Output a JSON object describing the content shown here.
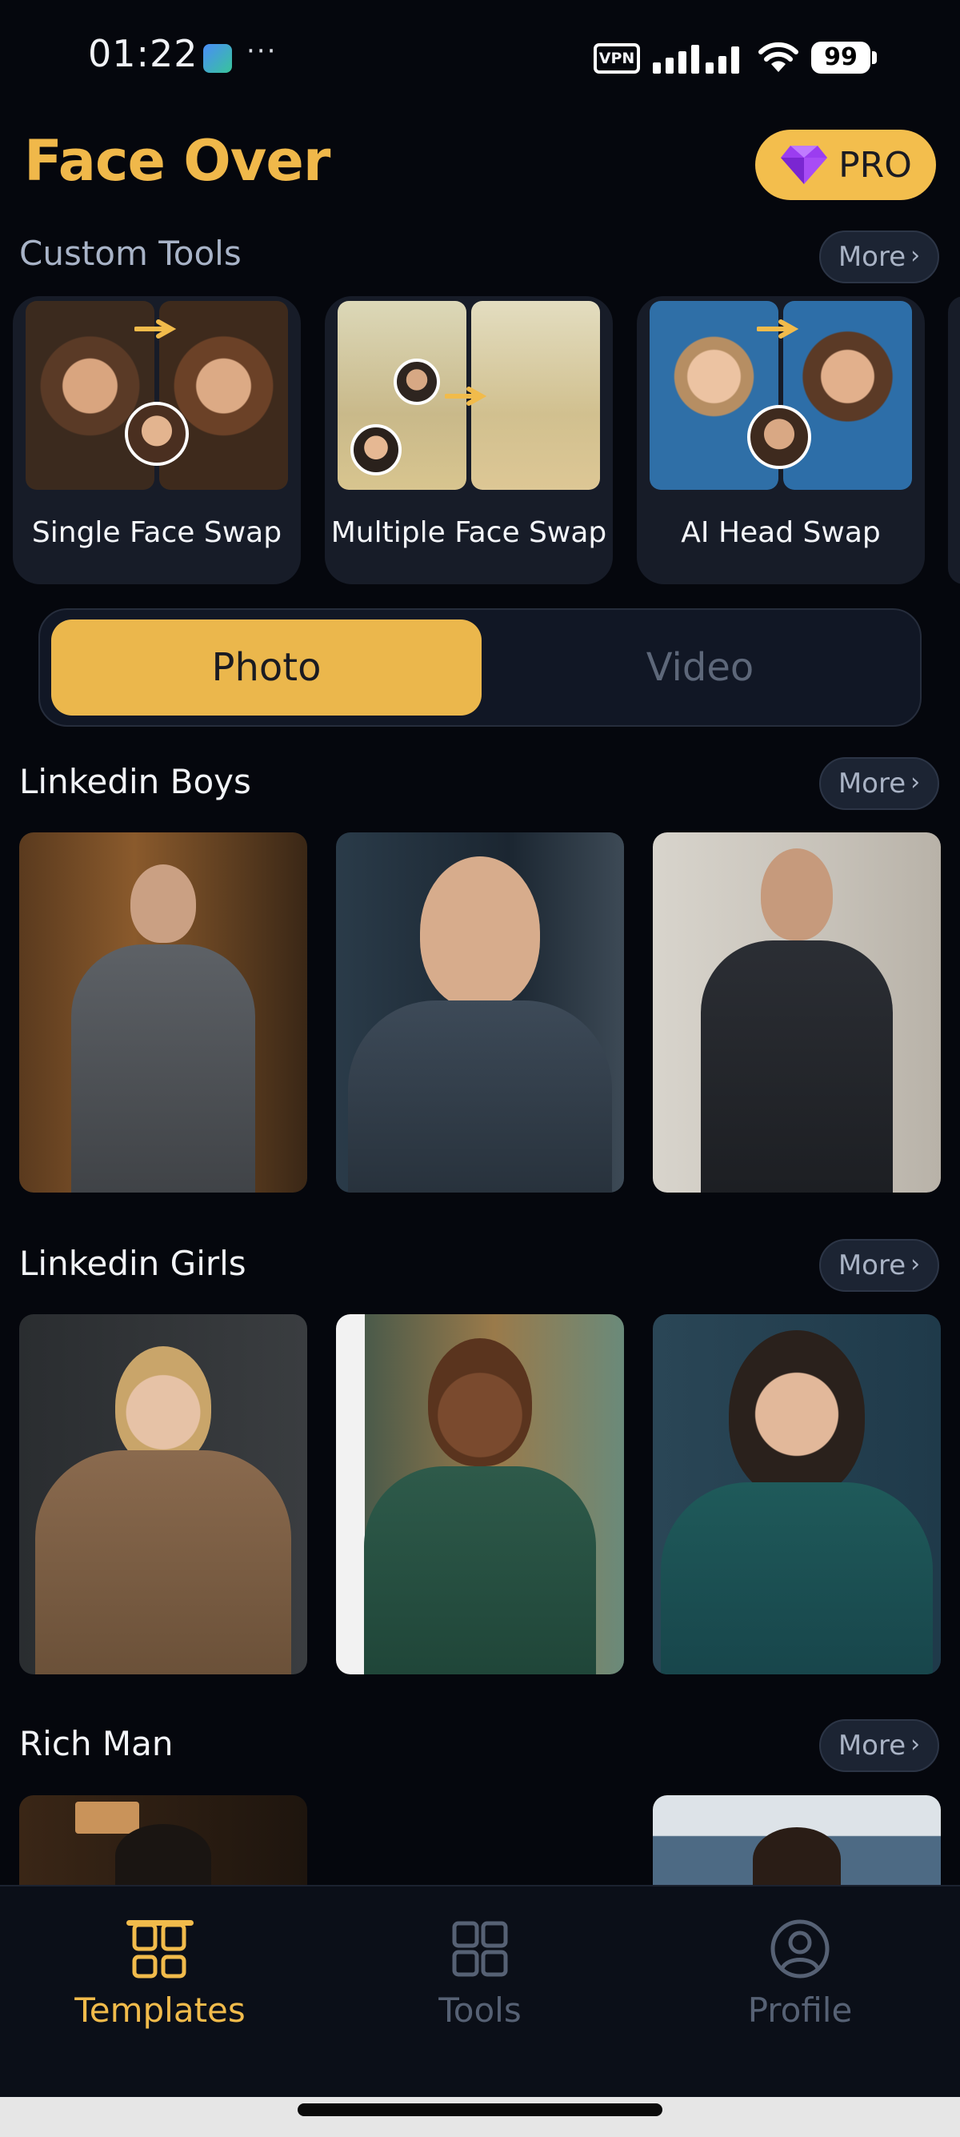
{
  "status_bar": {
    "time": "01:22",
    "dots": "···",
    "vpn": "VPN",
    "battery": "99"
  },
  "header": {
    "title": "Face Over",
    "pro_label": "PRO"
  },
  "custom_tools": {
    "title": "Custom Tools",
    "more": "More",
    "items": [
      {
        "label": "Single Face Swap"
      },
      {
        "label": "Multiple Face Swap"
      },
      {
        "label": "AI Head Swap"
      }
    ]
  },
  "media_toggle": {
    "photo": "Photo",
    "video": "Video",
    "selected": "Photo"
  },
  "sections": [
    {
      "title": "Linkedin Boys",
      "more": "More"
    },
    {
      "title": "Linkedin Girls",
      "more": "More"
    },
    {
      "title": "Rich Man",
      "more": "More"
    }
  ],
  "bottom_nav": {
    "items": [
      {
        "label": "Templates",
        "icon": "templates-icon",
        "active": true
      },
      {
        "label": "Tools",
        "icon": "tools-icon",
        "active": false
      },
      {
        "label": "Profile",
        "icon": "profile-icon",
        "active": false
      }
    ]
  },
  "colors": {
    "accent": "#f1bb4b",
    "background": "#05070d",
    "card": "#171c28",
    "inactive": "#566174"
  }
}
